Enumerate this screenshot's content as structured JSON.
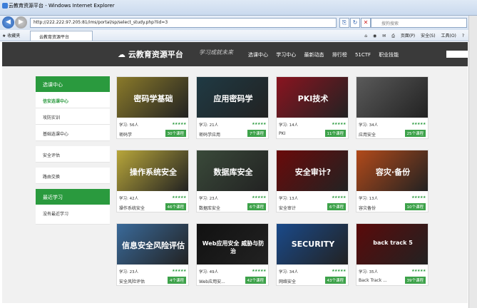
{
  "browser": {
    "window_title": "云教育资源平台 - Windows Internet Explorer",
    "url": "http://222.222.97.205:81/ims/portal/sp/select_study.php?lid=3",
    "search_placeholder": "搜狗搜索",
    "favorites_label": "收藏夹",
    "tab_title": "云教育资源平台",
    "commands": [
      "页面(P)",
      "安全(S)",
      "工具(O)"
    ]
  },
  "site": {
    "logo_text": "云教育资源平台",
    "slogan": "学习成就未来",
    "nav": [
      "选课中心",
      "学习中心",
      "最新动态",
      "排行榜",
      "51CTF",
      "职业技能"
    ]
  },
  "sidebar": {
    "section1_title": "选课中心",
    "section1_items": [
      "信安选课中心",
      "攻防实训",
      "基础选课中心"
    ],
    "section2_items": [
      "安全评估",
      "路由交换"
    ],
    "section3_title": "最近学习",
    "section3_items": [
      "没有最近学习"
    ]
  },
  "courses": [
    {
      "cover": "密码学基础",
      "learners": "56人",
      "name": "密码学",
      "count": "30个课程",
      "color": "#8a7a2a"
    },
    {
      "cover": "应用密码学",
      "learners": "21人",
      "name": "密码学应用",
      "count": "7个课程",
      "color": "#1f3a44"
    },
    {
      "cover": "PKI技术",
      "learners": "14人",
      "name": "PKI",
      "count": "11个课程",
      "color": "#8a1420"
    },
    {
      "cover": "",
      "learners": "34人",
      "name": "应用安全",
      "count": "25个课程",
      "color": "#5a5a5a"
    },
    {
      "cover": "操作系统安全",
      "learners": "42人",
      "name": "操作系统安全",
      "count": "46个课程",
      "color": "#b8a63a"
    },
    {
      "cover": "数据库安全",
      "learners": "23人",
      "name": "数据库安全",
      "count": "6个课程",
      "color": "#3a4a3a"
    },
    {
      "cover": "安全审计?",
      "learners": "13人",
      "name": "安全审计",
      "count": "6个课程",
      "color": "#6a0a0a"
    },
    {
      "cover": "容灾·备份",
      "learners": "13人",
      "name": "容灾备份",
      "count": "10个课程",
      "color": "#b24a1a"
    },
    {
      "cover": "信息安全风险评估",
      "learners": "23人",
      "name": "安全风险评估",
      "count": "4个课程",
      "color": "#3a6a9a"
    },
    {
      "cover": "Web应用安全 威胁与防治",
      "learners": "49人",
      "name": "Web应用安...",
      "count": "42个课程",
      "color": "#111111"
    },
    {
      "cover": "SECURITY",
      "learners": "34人",
      "name": "网络安全",
      "count": "43个课程",
      "color": "#1a4a8a"
    },
    {
      "cover": "back track 5",
      "learners": "35人",
      "name": "Back Track ...",
      "count": "39个课程",
      "color": "#5a0a0a"
    }
  ],
  "labels": {
    "learn": "学习:",
    "stars": "★★★★★"
  }
}
